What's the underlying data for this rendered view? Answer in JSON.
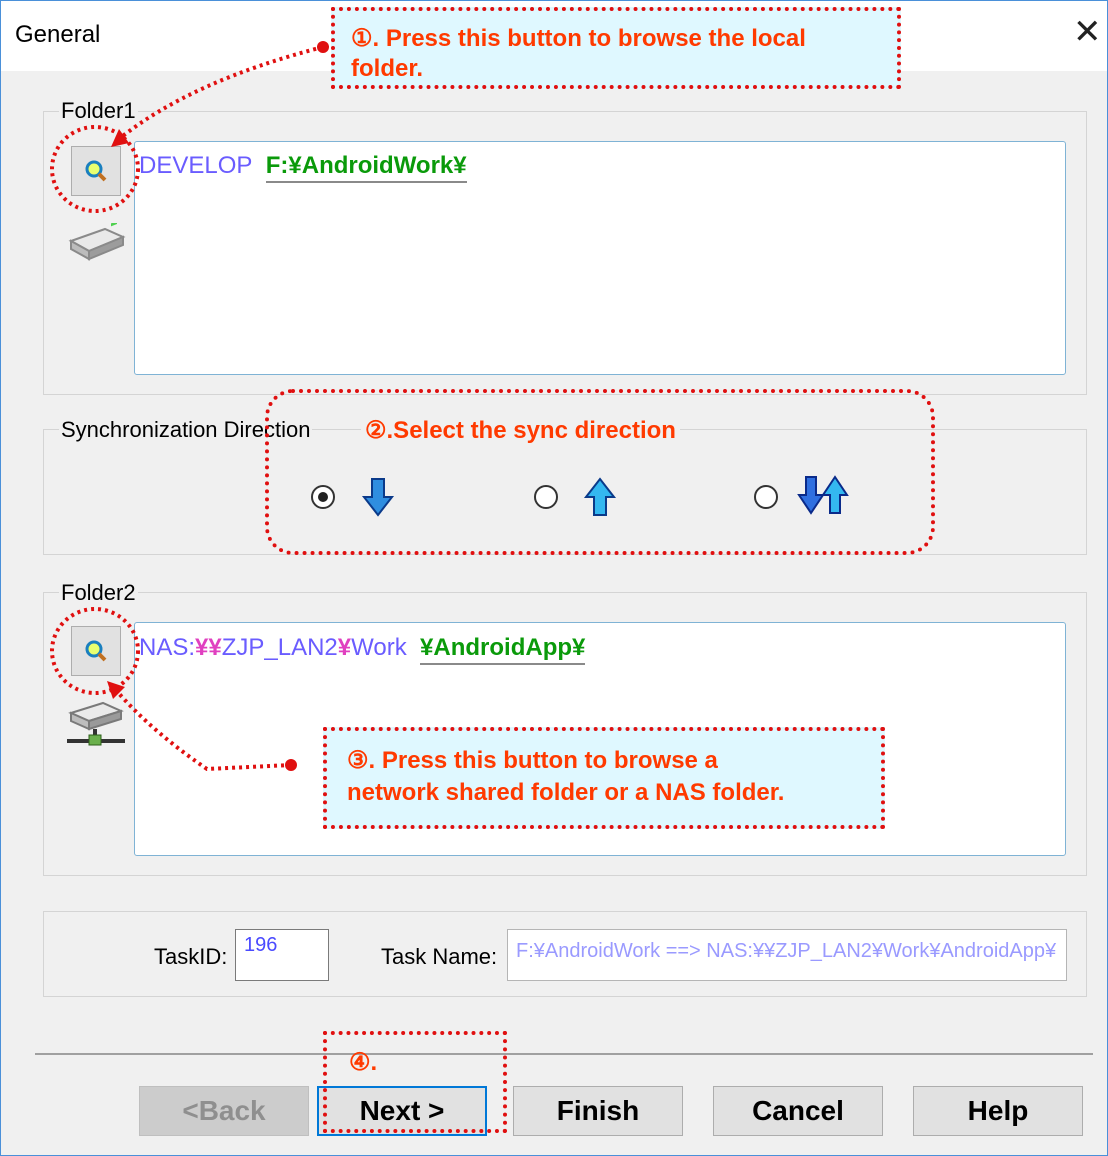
{
  "dialog": {
    "title": "General"
  },
  "folder1": {
    "label": "Folder1",
    "prefix": "DEVELOP",
    "path": "F:¥AndroidWork¥"
  },
  "sync": {
    "label": "Synchronization Direction",
    "options": [
      {
        "name": "download-arrow-icon",
        "selected": true
      },
      {
        "name": "upload-arrow-icon",
        "selected": false
      },
      {
        "name": "bidirectional-arrow-icon",
        "selected": false
      }
    ]
  },
  "folder2": {
    "label": "Folder2",
    "prefix": "NAS:",
    "share": "¥¥",
    "host": "ZJP_LAN2",
    "sep": "¥",
    "work": "Work",
    "path": "¥AndroidApp¥"
  },
  "task": {
    "id_label": "TaskID:",
    "id_value": "196",
    "name_label": "Task Name:",
    "name_value": "F:¥AndroidWork ==> NAS:¥¥ZJP_LAN2¥Work¥AndroidApp¥"
  },
  "buttons": {
    "back": "<Back",
    "next": "Next >",
    "finish": "Finish",
    "cancel": "Cancel",
    "help": "Help"
  },
  "annotations": {
    "a1_line1": "①. Press this button to browse the local",
    "a1_line2": "folder.",
    "a2": "②.Select the sync direction",
    "a3_line1": "③. Press this button to browse a",
    "a3_line2": "network shared folder or a NAS folder.",
    "a4": "④."
  },
  "colors": {
    "annotation": "#ff3a00",
    "annotation_border": "#e01010",
    "path_prefix": "#6a5cff",
    "path_highlight": "#0a9a0a",
    "share_mark": "#e040c0"
  }
}
